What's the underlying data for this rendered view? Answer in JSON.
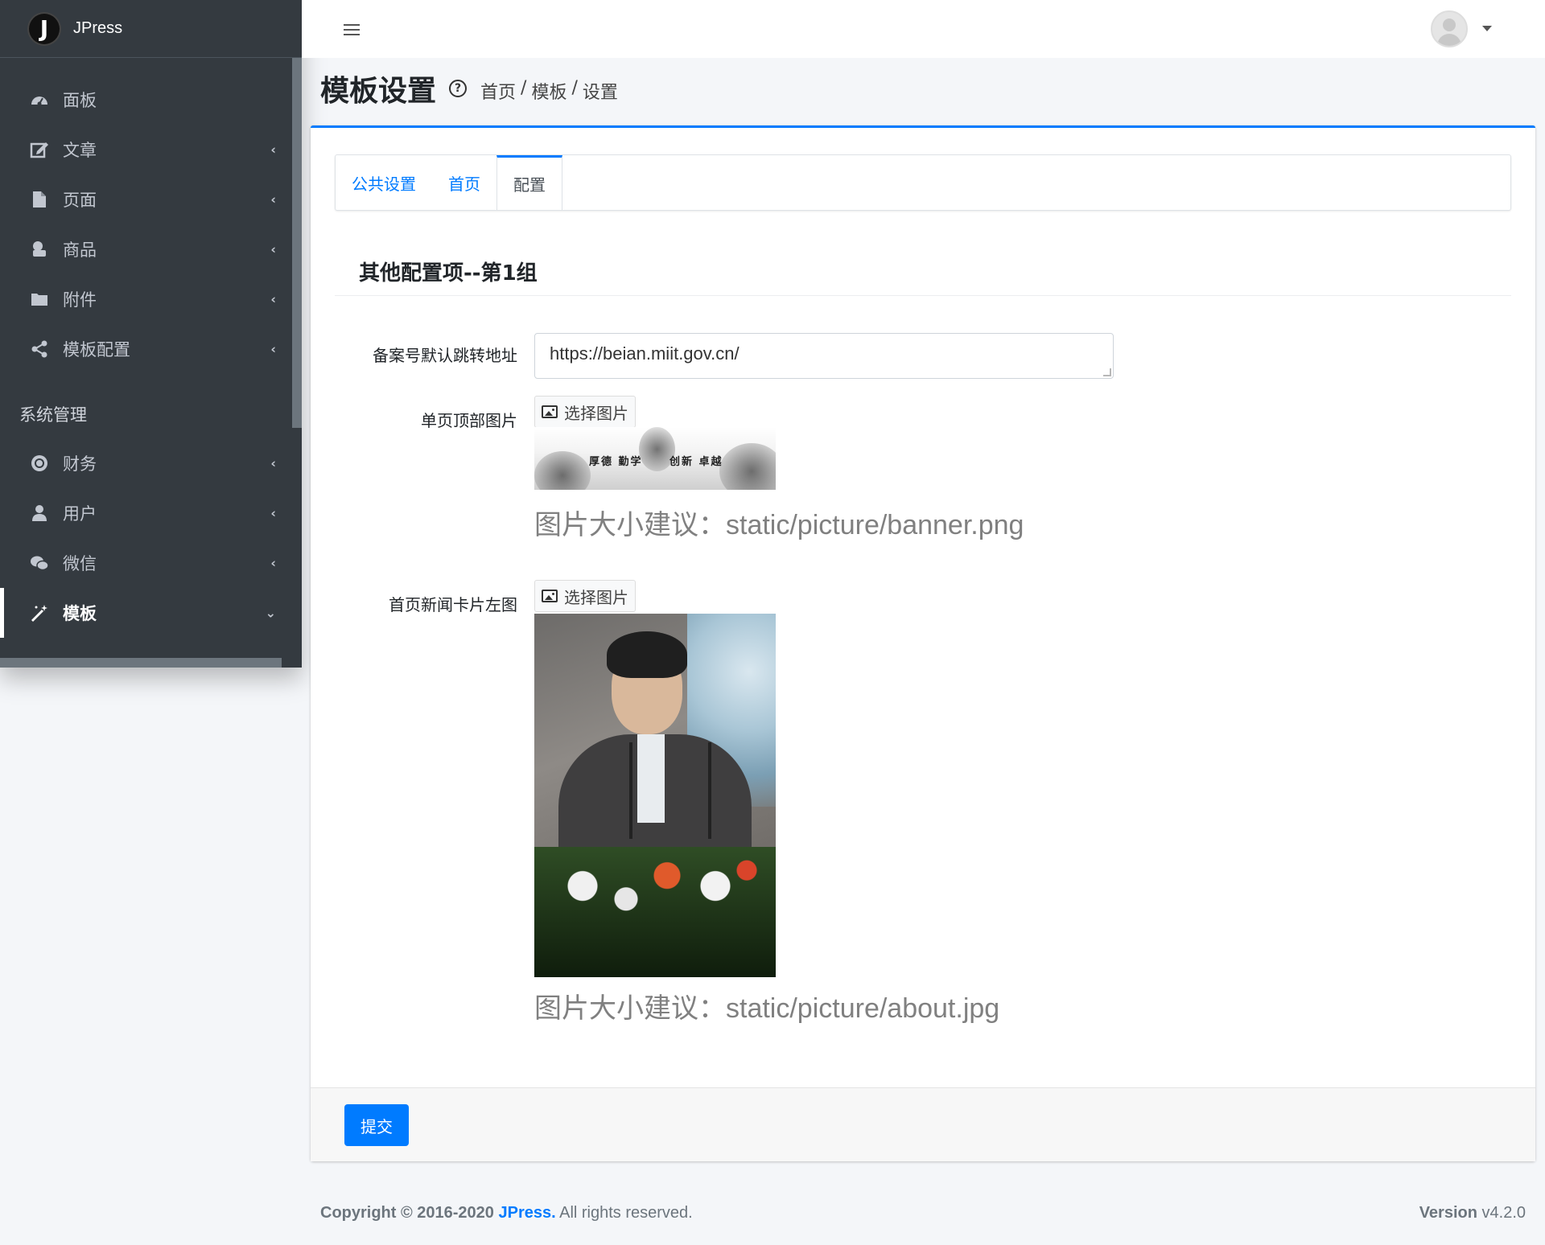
{
  "brand": {
    "logo_letter": "J",
    "name": "JPress"
  },
  "sidebar": {
    "items": [
      {
        "label": "面板",
        "icon": "dashboard-icon",
        "has_arrow": false
      },
      {
        "label": "文章",
        "icon": "edit-icon",
        "has_arrow": true
      },
      {
        "label": "页面",
        "icon": "file-icon",
        "has_arrow": true
      },
      {
        "label": "商品",
        "icon": "product-icon",
        "has_arrow": true
      },
      {
        "label": "附件",
        "icon": "folder-icon",
        "has_arrow": true
      },
      {
        "label": "模板配置",
        "icon": "share-icon",
        "has_arrow": true
      }
    ],
    "section_header": "系统管理",
    "system_items": [
      {
        "label": "财务",
        "icon": "finance-icon",
        "has_arrow": true
      },
      {
        "label": "用户",
        "icon": "user-icon",
        "has_arrow": true
      },
      {
        "label": "微信",
        "icon": "wechat-icon",
        "has_arrow": true
      },
      {
        "label": "模板",
        "icon": "magic-wand-icon",
        "active": true
      }
    ]
  },
  "header": {
    "title": "模板设置",
    "breadcrumb": [
      "首页",
      "模板",
      "设置"
    ],
    "breadcrumb_sep": "/"
  },
  "tabs": [
    {
      "label": "公共设置",
      "active": false
    },
    {
      "label": "首页",
      "active": false
    },
    {
      "label": "配置",
      "active": true
    }
  ],
  "section": {
    "title": "其他配置项--第1组",
    "fields": {
      "icp_url": {
        "label": "备案号默认跳转地址",
        "value": "https://beian.miit.gov.cn/"
      },
      "page_top_image": {
        "label": "单页顶部图片",
        "button": "选择图片",
        "hint": "图片大小建议：static/picture/banner.png",
        "banner_text_1": "厚德 勤学",
        "banner_text_2": "创新 卓越"
      },
      "news_card_image": {
        "label": "首页新闻卡片左图",
        "button": "选择图片",
        "hint": "图片大小建议：static/picture/about.jpg"
      }
    }
  },
  "footer_actions": {
    "submit": "提交"
  },
  "footer": {
    "copyright_prefix": "Copyright © 2016-2020 ",
    "copyright_brand": "JPress.",
    "copyright_suffix": " All rights reserved.",
    "version_label": "Version",
    "version_value": " v4.2.0"
  },
  "colors": {
    "primary": "#007bff",
    "sidebar_bg": "#343a40"
  }
}
